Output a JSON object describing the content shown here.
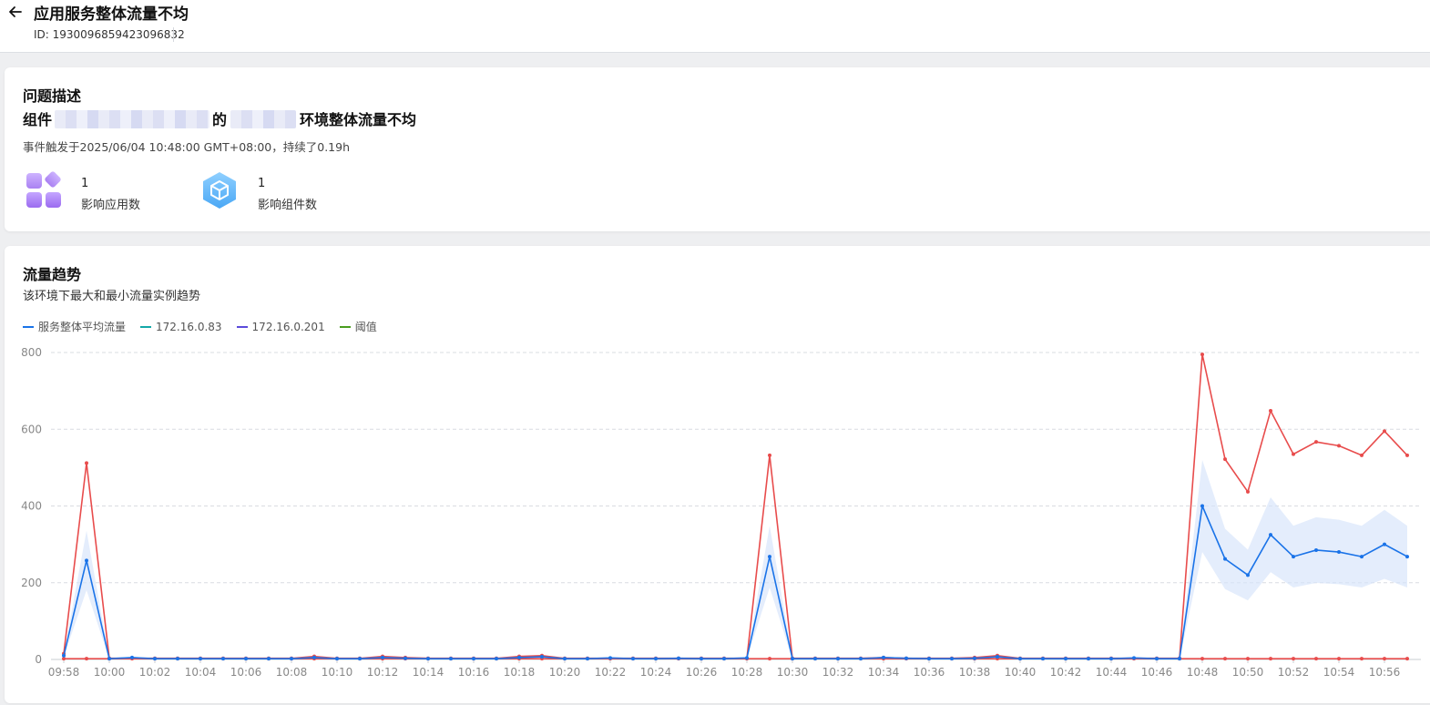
{
  "header": {
    "title": "应用服务整体流量不均",
    "id_text": "ID: 1930096859423096832"
  },
  "problem": {
    "section_title": "问题描述",
    "line_prefix": "组件",
    "line_middle": "的",
    "line_suffix": "环境整体流量不均",
    "meta": "事件触发于2025/06/04 10:48:00 GMT+08:00，持续了0.19h",
    "stats": [
      {
        "value": "1",
        "label": "影响应用数",
        "icon": "apps-icon"
      },
      {
        "value": "1",
        "label": "影响组件数",
        "icon": "cube-icon"
      }
    ]
  },
  "trend": {
    "section_title": "流量趋势",
    "subtitle": "该环境下最大和最小流量实例趋势",
    "legend": [
      {
        "name": "服务整体平均流量",
        "color": "#1a73e8"
      },
      {
        "name": "172.16.0.83",
        "color": "#13a8a8"
      },
      {
        "name": "172.16.0.201",
        "color": "#5b4bdb"
      },
      {
        "name": "阈值",
        "color": "#4a9d1f"
      }
    ]
  },
  "chart_data": {
    "type": "line",
    "x": [
      "09:58",
      "09:59",
      "10:00",
      "10:01",
      "10:02",
      "10:03",
      "10:04",
      "10:05",
      "10:06",
      "10:07",
      "10:08",
      "10:09",
      "10:10",
      "10:11",
      "10:12",
      "10:13",
      "10:14",
      "10:15",
      "10:16",
      "10:17",
      "10:18",
      "10:19",
      "10:20",
      "10:21",
      "10:22",
      "10:23",
      "10:24",
      "10:25",
      "10:26",
      "10:27",
      "10:28",
      "10:29",
      "10:30",
      "10:31",
      "10:32",
      "10:33",
      "10:34",
      "10:35",
      "10:36",
      "10:37",
      "10:38",
      "10:39",
      "10:40",
      "10:41",
      "10:42",
      "10:43",
      "10:44",
      "10:45",
      "10:46",
      "10:47",
      "10:48",
      "10:49",
      "10:50",
      "10:51",
      "10:52",
      "10:53",
      "10:54",
      "10:55",
      "10:56",
      "10:57"
    ],
    "x_tick_labels": [
      "09:58",
      "10:00",
      "10:02",
      "10:04",
      "10:06",
      "10:08",
      "10:10",
      "10:12",
      "10:14",
      "10:16",
      "10:18",
      "10:20",
      "10:22",
      "10:24",
      "10:26",
      "10:28",
      "10:30",
      "10:32",
      "10:34",
      "10:36",
      "10:38",
      "10:40",
      "10:42",
      "10:44",
      "10:46",
      "10:48",
      "10:50",
      "10:52",
      "10:54",
      "10:56"
    ],
    "y_ticks": [
      0,
      200,
      400,
      600,
      800
    ],
    "ylim": [
      0,
      800
    ],
    "grid": true,
    "series": [
      {
        "name": "服务整体平均流量",
        "color": "#1a73e8",
        "values": [
          10,
          258,
          2,
          5,
          2,
          2,
          2,
          2,
          2,
          2,
          2,
          5,
          2,
          2,
          5,
          3,
          2,
          2,
          2,
          2,
          5,
          7,
          2,
          2,
          4,
          2,
          2,
          3,
          2,
          2,
          4,
          268,
          2,
          2,
          2,
          2,
          5,
          3,
          2,
          2,
          3,
          7,
          2,
          2,
          2,
          2,
          2,
          4,
          2,
          2,
          400,
          262,
          220,
          325,
          268,
          285,
          280,
          268,
          300,
          268
        ]
      },
      {
        "color": "#e84c4c",
        "values": [
          15,
          512,
          3,
          3,
          3,
          3,
          3,
          3,
          3,
          3,
          3,
          8,
          3,
          3,
          8,
          5,
          3,
          3,
          3,
          3,
          8,
          10,
          3,
          3,
          3,
          3,
          3,
          3,
          3,
          3,
          3,
          532,
          3,
          3,
          3,
          3,
          5,
          3,
          3,
          3,
          5,
          10,
          3,
          3,
          3,
          3,
          3,
          3,
          3,
          3,
          795,
          522,
          437,
          648,
          535,
          567,
          557,
          532,
          595,
          532
        ]
      },
      {
        "color": "#e84c4c",
        "values": [
          2,
          2,
          2,
          2,
          2,
          2,
          2,
          2,
          2,
          2,
          2,
          2,
          2,
          2,
          2,
          2,
          2,
          2,
          2,
          2,
          2,
          2,
          2,
          2,
          2,
          2,
          2,
          2,
          2,
          2,
          2,
          2,
          2,
          2,
          2,
          2,
          2,
          2,
          2,
          2,
          2,
          2,
          2,
          2,
          2,
          2,
          2,
          2,
          2,
          2,
          2,
          2,
          2,
          2,
          2,
          2,
          2,
          2,
          2,
          2
        ]
      }
    ]
  }
}
